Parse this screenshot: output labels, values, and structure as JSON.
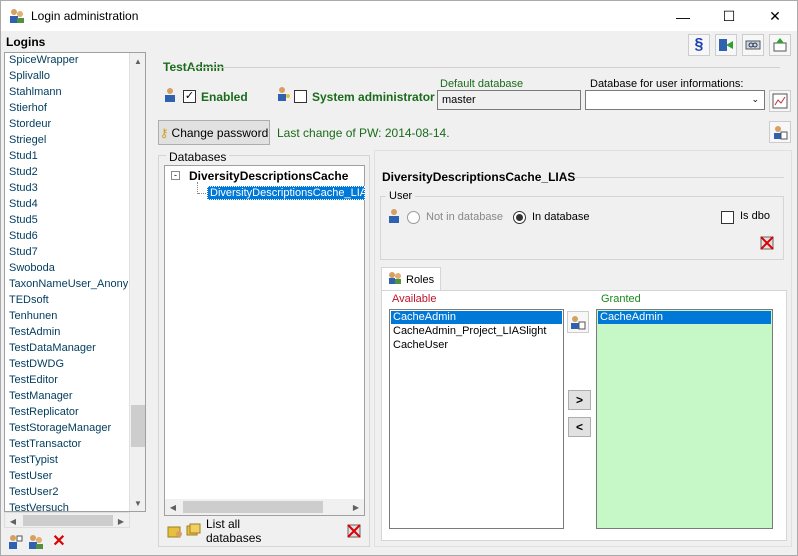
{
  "window": {
    "title": "Login administration",
    "minimize": "—",
    "maximize": "☐",
    "close": "✕"
  },
  "logins": {
    "label": "Logins",
    "items": [
      "SpiceWrapper",
      "Splivallo",
      "Stahlmann",
      "Stierhof",
      "Stordeur",
      "Striegel",
      "Stud1",
      "Stud2",
      "Stud3",
      "Stud4",
      "Stud5",
      "Stud6",
      "Stud7",
      "Swoboda",
      "TaxonNameUser_Anonym",
      "TEDsoft",
      "Tenhunen",
      "TestAdmin",
      "TestDataManager",
      "TestDWDG",
      "TestEditor",
      "TestManager",
      "TestReplicator",
      "TestStorageManager",
      "TestTransactor",
      "TestTypist",
      "TestUser",
      "TestUser2",
      "TestVersuch"
    ]
  },
  "login": {
    "name": "TestAdmin",
    "enabled_label": "Enabled",
    "enabled_checked": "✓",
    "sysadmin_label": "System administrator",
    "default_db_label": "Default database",
    "default_db_value": "master",
    "userinfo_db_label": "Database for user informations:",
    "userinfo_db_value": "",
    "change_pw_label": "Change password",
    "last_change_label": "Last change of PW: 2014-08-14."
  },
  "databases": {
    "label": "Databases",
    "root": "DiversityDescriptionsCache",
    "child": "DiversityDescriptionsCache_LIAS",
    "list_all_label": "List all databases"
  },
  "detail": {
    "title": "DiversityDescriptionsCache_LIAS",
    "user_group": "User",
    "not_in_db": "Not in database",
    "in_db": "In database",
    "is_dbo": "Is dbo",
    "roles_tab": "Roles",
    "available_label": "Available",
    "granted_label": "Granted",
    "available": [
      "CacheAdmin",
      "CacheAdmin_Project_LIASlight",
      "CacheUser"
    ],
    "granted": [
      "CacheAdmin"
    ],
    "grant_btn": ">",
    "revoke_btn": "<"
  },
  "toolbar": {
    "paragraph_icon": "§"
  },
  "colors": {
    "accent_green": "#1a6b1a",
    "available_red": "#c0142b",
    "granted_bg": "#c6f7c6",
    "selection": "#0078d7"
  }
}
